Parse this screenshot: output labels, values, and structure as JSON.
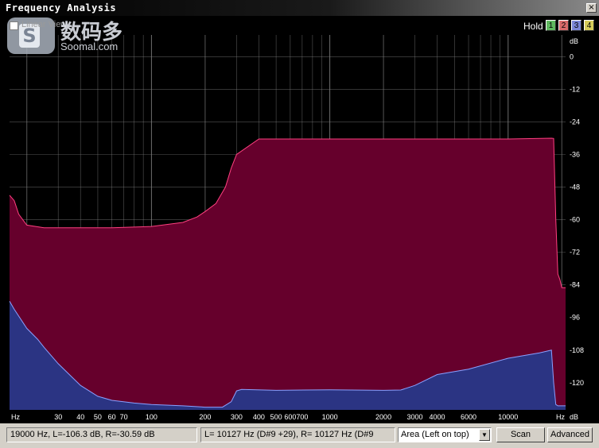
{
  "window": {
    "title": "Frequency Analysis",
    "close_glyph": "×"
  },
  "toolbar": {
    "linear_view_label": "Linear View",
    "hold_label": "Hold",
    "hold_buttons": [
      "1",
      "2",
      "3",
      "4"
    ],
    "hold_colors": [
      "#5fb85f",
      "#d86a6a",
      "#7a86d6",
      "#d6cc5a"
    ]
  },
  "watermark": {
    "cn": "数码多",
    "en": "Soomal.com",
    "logo_letter": "S"
  },
  "chart_data": {
    "type": "area",
    "xscale": "log",
    "x_unit_label_left": "Hz",
    "x_unit_label_right": "Hz",
    "y_unit_label": "dB",
    "xlim": [
      16,
      21000
    ],
    "ylim": [
      -130,
      8
    ],
    "x_ticks": [
      30,
      40,
      50,
      60,
      70,
      100,
      200,
      300,
      400,
      500,
      600,
      700,
      1000,
      2000,
      3000,
      4000,
      6000,
      10000
    ],
    "x_tick_labels": [
      "30",
      "40",
      "50",
      "60",
      "70",
      "100",
      "200",
      "300",
      "400",
      "500",
      "600",
      "700",
      "1000",
      "2000",
      "3000",
      "4000",
      "6000",
      "10000"
    ],
    "y_ticks": [
      0,
      -12,
      -24,
      -36,
      -48,
      -60,
      -72,
      -84,
      -96,
      -108,
      -120
    ],
    "y_tick_labels": [
      "0",
      "-12",
      "-24",
      "-36",
      "-48",
      "-60",
      "-72",
      "-84",
      "-96",
      "-108",
      "-120"
    ],
    "grid": true,
    "colors": {
      "background": "#000000",
      "right_channel": "#66002c",
      "right_edge": "#ff4080",
      "left_channel": "#2b3483",
      "left_edge": "#8aa0ff",
      "grid": "#7a7a7a",
      "text": "#ffffff"
    },
    "series": [
      {
        "name": "R",
        "x": [
          16,
          17,
          18,
          20,
          25,
          40,
          60,
          100,
          150,
          180,
          200,
          230,
          260,
          280,
          300,
          400,
          1000,
          3000,
          10000,
          17500,
          18000,
          18500,
          19000,
          19500,
          20000,
          21000
        ],
        "y": [
          -51,
          -53,
          -58,
          -62,
          -63,
          -63,
          -63,
          -62.5,
          -61,
          -59,
          -57,
          -54,
          -48,
          -41,
          -36,
          -30.3,
          -30.3,
          -30.3,
          -30.3,
          -30,
          -30.1,
          -60,
          -80,
          -82,
          -85,
          -85
        ]
      },
      {
        "name": "L",
        "x": [
          16,
          17,
          20,
          23,
          25,
          30,
          40,
          50,
          60,
          80,
          100,
          150,
          200,
          250,
          280,
          300,
          320,
          500,
          1000,
          2000,
          2500,
          3000,
          4000,
          6000,
          10000,
          15000,
          17500,
          18000,
          18500,
          19000,
          19500,
          20000,
          21000
        ],
        "y": [
          -90,
          -93,
          -100,
          -104,
          -107,
          -113,
          -121,
          -125,
          -126.5,
          -127.5,
          -128,
          -128.5,
          -129,
          -129,
          -127,
          -123,
          -122.5,
          -122.8,
          -122.6,
          -122.8,
          -122.7,
          -121,
          -117,
          -115,
          -111,
          -109,
          -108,
          -120,
          -128,
          -128.5,
          -128.5,
          -128.5,
          -128.5
        ]
      }
    ]
  },
  "status": {
    "cursor_readout": "19000 Hz, L=-106.3 dB, R=-30.59 dB",
    "peak_readout": "L=  10127 Hz (D#9 +29), R=  10127 Hz (D#9"
  },
  "controls": {
    "view_mode": "Area (Left on top)",
    "dropdown_glyph": "▼",
    "scan_label": "Scan",
    "advanced_label": "Advanced"
  }
}
